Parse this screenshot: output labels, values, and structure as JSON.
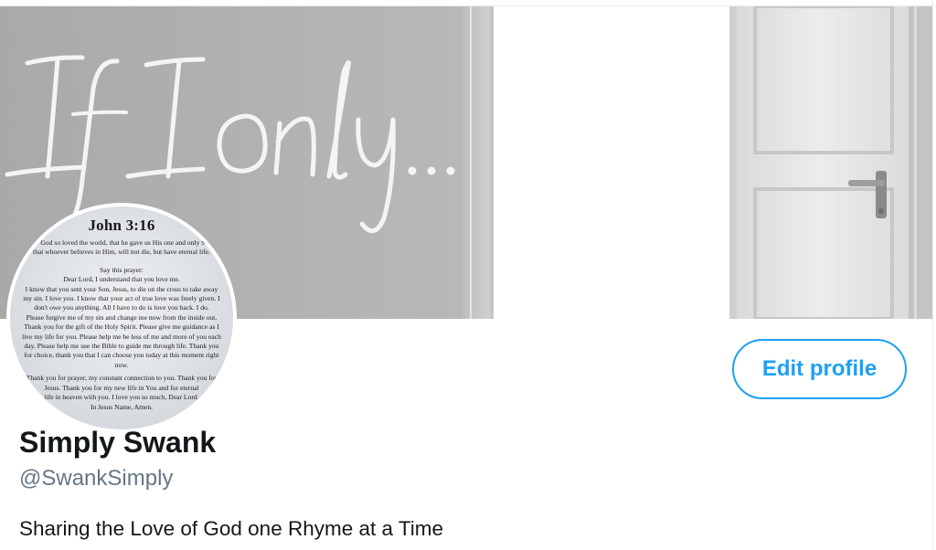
{
  "banner": {
    "script_text": "If I only..."
  },
  "avatar": {
    "title": "John 3:16",
    "verse_lines": [
      "For God so loved the world, that he gave us His one and only Son,",
      "that whoever believes in Him, will not die, but have eternal life."
    ],
    "prayer_lines": [
      "Say this prayer:",
      "Dear Lord, I understand that you love me.",
      "I know that you sent your Son, Jesus, to die on the cross to take away",
      "my sin. I love you. I know that your act of true love was freely given. I",
      "don't owe you anything. All I have to do is love you back. I do.",
      "Please forgive me of my sin and change me now from the inside out.",
      "Thank you for the gift of the Holy Spirit. Please give me guidance as I",
      "live my life for you. Please help me be less of me and more of you each",
      "day. Please help me use the Bible to guide me through life. Thank you",
      "for choice, thank you that I can choose you today at this moment right",
      "now."
    ],
    "closing_lines": [
      "Thank you for prayer, my constant connection to you. Thank you for",
      "Jesus. Thank you for my new life in You and for eternal",
      "life in heaven with you. I love you so much, Dear Lord.",
      "In Jesus Name, Amen."
    ]
  },
  "profile": {
    "edit_button_label": "Edit profile",
    "display_name": "Simply Swank",
    "handle": "@SwankSimply",
    "bio": "Sharing the Love of God one Rhyme at a Time"
  },
  "colors": {
    "accent": "#1da1f2",
    "name_text": "#14171a",
    "secondary_text": "#657786",
    "banner_wall": "#b3b3b3"
  }
}
